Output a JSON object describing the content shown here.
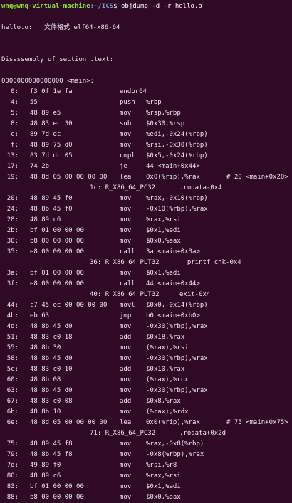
{
  "prompt": {
    "user_host": "wnq@wnq-virtual-machine",
    "path": ":~/ICS",
    "symbol": "$ ",
    "command": "objdump -d -r hello.o"
  },
  "file_header": {
    "name": "hello.o:",
    "format_label": "文件格式",
    "format_value": "elf64-x86-64"
  },
  "section_title": "Disassembly of section .text:",
  "function_header": "0000000000000000 <main>:",
  "lines": [
    {
      "kind": "ins",
      "addr": "0:",
      "bytes": "f3 0f 1e fa",
      "mn": "endbr64",
      "ops": "",
      "cmt": ""
    },
    {
      "kind": "ins",
      "addr": "4:",
      "bytes": "55",
      "mn": "push",
      "ops": "%rbp",
      "cmt": ""
    },
    {
      "kind": "ins",
      "addr": "5:",
      "bytes": "48 89 e5",
      "mn": "mov",
      "ops": "%rsp,%rbp",
      "cmt": ""
    },
    {
      "kind": "ins",
      "addr": "8:",
      "bytes": "48 83 ec 30",
      "mn": "sub",
      "ops": "$0x30,%rsp",
      "cmt": ""
    },
    {
      "kind": "ins",
      "addr": "c:",
      "bytes": "89 7d dc",
      "mn": "mov",
      "ops": "%edi,-0x24(%rbp)",
      "cmt": ""
    },
    {
      "kind": "ins",
      "addr": "f:",
      "bytes": "48 89 75 d0",
      "mn": "mov",
      "ops": "%rsi,-0x30(%rbp)",
      "cmt": ""
    },
    {
      "kind": "ins",
      "addr": "13:",
      "bytes": "83 7d dc 05",
      "mn": "cmpl",
      "ops": "$0x5,-0x24(%rbp)",
      "cmt": ""
    },
    {
      "kind": "ins",
      "addr": "17:",
      "bytes": "74 2b",
      "mn": "je",
      "ops": "44 <main+0x44>",
      "cmt": ""
    },
    {
      "kind": "ins",
      "addr": "19:",
      "bytes": "48 8d 05 00 00 00 00",
      "mn": "lea",
      "ops": "0x0(%rip),%rax",
      "cmt": "# 20 <main+0x20>"
    },
    {
      "kind": "rel",
      "off": "1c:",
      "type": "R_X86_64_PC32",
      "sym": ".rodata-0x4"
    },
    {
      "kind": "ins",
      "addr": "20:",
      "bytes": "48 89 45 f0",
      "mn": "mov",
      "ops": "%rax,-0x10(%rbp)",
      "cmt": ""
    },
    {
      "kind": "ins",
      "addr": "24:",
      "bytes": "48 8b 45 f0",
      "mn": "mov",
      "ops": "-0x10(%rbp),%rax",
      "cmt": ""
    },
    {
      "kind": "ins",
      "addr": "28:",
      "bytes": "48 89 c6",
      "mn": "mov",
      "ops": "%rax,%rsi",
      "cmt": ""
    },
    {
      "kind": "ins",
      "addr": "2b:",
      "bytes": "bf 01 00 00 00",
      "mn": "mov",
      "ops": "$0x1,%edi",
      "cmt": ""
    },
    {
      "kind": "ins",
      "addr": "30:",
      "bytes": "b8 00 00 00 00",
      "mn": "mov",
      "ops": "$0x0,%eax",
      "cmt": ""
    },
    {
      "kind": "ins",
      "addr": "35:",
      "bytes": "e8 00 00 00 00",
      "mn": "call",
      "ops": "3a <main+0x3a>",
      "cmt": ""
    },
    {
      "kind": "rel",
      "off": "36:",
      "type": "R_X86_64_PLT32",
      "sym": "__printf_chk-0x4"
    },
    {
      "kind": "ins",
      "addr": "3a:",
      "bytes": "bf 01 00 00 00",
      "mn": "mov",
      "ops": "$0x1,%edi",
      "cmt": ""
    },
    {
      "kind": "ins",
      "addr": "3f:",
      "bytes": "e8 00 00 00 00",
      "mn": "call",
      "ops": "44 <main+0x44>",
      "cmt": ""
    },
    {
      "kind": "rel",
      "off": "40:",
      "type": "R_X86_64_PLT32",
      "sym": "exit-0x4"
    },
    {
      "kind": "ins",
      "addr": "44:",
      "bytes": "c7 45 ec 00 00 00 00",
      "mn": "movl",
      "ops": "$0x0,-0x14(%rbp)",
      "cmt": ""
    },
    {
      "kind": "ins",
      "addr": "4b:",
      "bytes": "eb 63",
      "mn": "jmp",
      "ops": "b0 <main+0xb0>",
      "cmt": ""
    },
    {
      "kind": "ins",
      "addr": "4d:",
      "bytes": "48 8b 45 d0",
      "mn": "mov",
      "ops": "-0x30(%rbp),%rax",
      "cmt": ""
    },
    {
      "kind": "ins",
      "addr": "51:",
      "bytes": "48 83 c0 18",
      "mn": "add",
      "ops": "$0x18,%rax",
      "cmt": ""
    },
    {
      "kind": "ins",
      "addr": "55:",
      "bytes": "48 8b 30",
      "mn": "mov",
      "ops": "(%rax),%rsi",
      "cmt": ""
    },
    {
      "kind": "ins",
      "addr": "58:",
      "bytes": "48 8b 45 d0",
      "mn": "mov",
      "ops": "-0x30(%rbp),%rax",
      "cmt": ""
    },
    {
      "kind": "ins",
      "addr": "5c:",
      "bytes": "48 83 c0 10",
      "mn": "add",
      "ops": "$0x10,%rax",
      "cmt": ""
    },
    {
      "kind": "ins",
      "addr": "60:",
      "bytes": "48 8b 08",
      "mn": "mov",
      "ops": "(%rax),%rcx",
      "cmt": ""
    },
    {
      "kind": "ins",
      "addr": "63:",
      "bytes": "48 8b 45 d0",
      "mn": "mov",
      "ops": "-0x30(%rbp),%rax",
      "cmt": ""
    },
    {
      "kind": "ins",
      "addr": "67:",
      "bytes": "48 83 c0 08",
      "mn": "add",
      "ops": "$0x8,%rax",
      "cmt": ""
    },
    {
      "kind": "ins",
      "addr": "6b:",
      "bytes": "48 8b 10",
      "mn": "mov",
      "ops": "(%rax),%rdx",
      "cmt": ""
    },
    {
      "kind": "ins",
      "addr": "6e:",
      "bytes": "48 8d 05 00 00 00 00",
      "mn": "lea",
      "ops": "0x0(%rip),%rax",
      "cmt": "# 75 <main+0x75>"
    },
    {
      "kind": "rel",
      "off": "71:",
      "type": "R_X86_64_PC32",
      "sym": ".rodata+0x2d"
    },
    {
      "kind": "ins",
      "addr": "75:",
      "bytes": "48 89 45 f8",
      "mn": "mov",
      "ops": "%rax,-0x8(%rbp)",
      "cmt": ""
    },
    {
      "kind": "ins",
      "addr": "79:",
      "bytes": "48 8b 45 f8",
      "mn": "mov",
      "ops": "-0x8(%rbp),%rax",
      "cmt": ""
    },
    {
      "kind": "ins",
      "addr": "7d:",
      "bytes": "49 89 f0",
      "mn": "mov",
      "ops": "%rsi,%r8",
      "cmt": ""
    },
    {
      "kind": "ins",
      "addr": "80:",
      "bytes": "48 89 c6",
      "mn": "mov",
      "ops": "%rax,%rsi",
      "cmt": ""
    },
    {
      "kind": "ins",
      "addr": "83:",
      "bytes": "bf 01 00 00 00",
      "mn": "mov",
      "ops": "$0x1,%edi",
      "cmt": ""
    },
    {
      "kind": "ins",
      "addr": "88:",
      "bytes": "b8 00 00 00 00",
      "mn": "mov",
      "ops": "$0x0,%eax",
      "cmt": ""
    }
  ]
}
